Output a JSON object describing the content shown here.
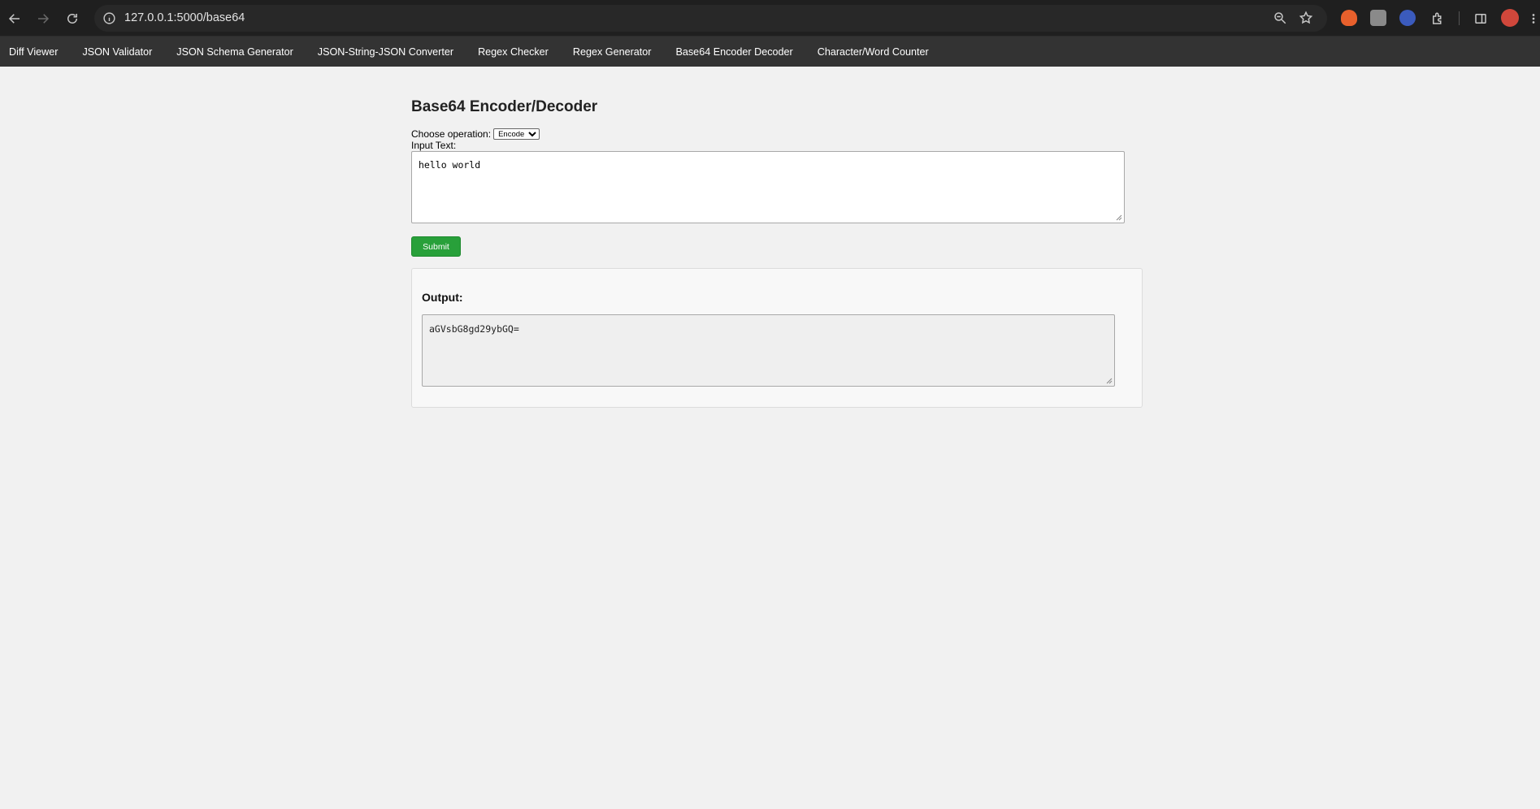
{
  "browser": {
    "url": "127.0.0.1:5000/base64"
  },
  "nav": {
    "items": [
      {
        "label": "Diff Viewer"
      },
      {
        "label": "JSON Validator"
      },
      {
        "label": "JSON Schema Generator"
      },
      {
        "label": "JSON-String-JSON Converter"
      },
      {
        "label": "Regex Checker"
      },
      {
        "label": "Regex Generator"
      },
      {
        "label": "Base64 Encoder Decoder"
      },
      {
        "label": "Character/Word Counter"
      }
    ]
  },
  "main": {
    "title": "Base64 Encoder/Decoder",
    "operation_label": "Choose operation:",
    "operation_selected": "Encode",
    "input_label": "Input Text:",
    "input_value": "hello world",
    "submit_label": "Submit",
    "output_title": "Output:",
    "output_value": "aGVsbG8gd29ybGQ="
  },
  "colors": {
    "nav_bg": "#333333",
    "submit_bg": "#28a03a",
    "page_bg": "#f1f1f1"
  }
}
